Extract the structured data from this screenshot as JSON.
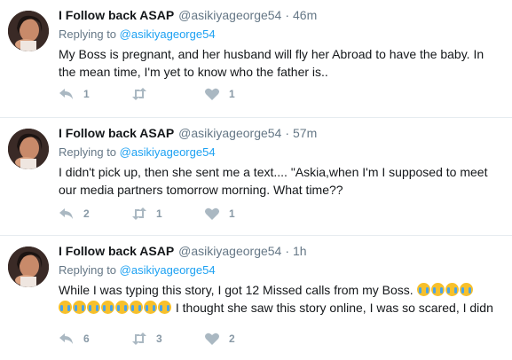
{
  "tweets": [
    {
      "name": "I Follow back ASAP",
      "handle": "@asikiyageorge54",
      "dot": "·",
      "time": "46m",
      "replying_prefix": "Replying to",
      "replying_to": "@asikiyageorge54",
      "text": "My Boss is pregnant, and her husband will fly her Abroad to have the baby. In the mean time, I'm yet to know who the father is..",
      "reply_count": "1",
      "retweet_count": "",
      "like_count": "1"
    },
    {
      "name": "I Follow back ASAP",
      "handle": "@asikiyageorge54",
      "dot": "·",
      "time": "57m",
      "replying_prefix": "Replying to",
      "replying_to": "@asikiyageorge54",
      "text": "I didn't pick up, then she sent me a text....  \"Askia,when I'm I supposed to meet our media partners tomorrow morning. What time??",
      "reply_count": "2",
      "retweet_count": "1",
      "like_count": "1"
    },
    {
      "name": "I Follow back ASAP",
      "handle": "@asikiyageorge54",
      "dot": "·",
      "time": "1h",
      "replying_prefix": "Replying to",
      "replying_to": "@asikiyageorge54",
      "text_start": "While I was typing this story, I got 12 Missed calls from my Boss.",
      "text_end": "I thought she saw this story online, I was so scared, I didn",
      "emoji_first_row": 4,
      "emoji_second_row": 8,
      "emoji_name": "loudly-crying-face",
      "reply_count": "6",
      "retweet_count": "3",
      "like_count": "2"
    }
  ],
  "colors": {
    "link": "#1da1f2",
    "muted": "#657786",
    "count": "#8899a6",
    "divider": "#e6ecf0"
  },
  "icons": {
    "reply": "reply-arrow-icon",
    "retweet": "retweet-icon",
    "like": "heart-icon"
  }
}
